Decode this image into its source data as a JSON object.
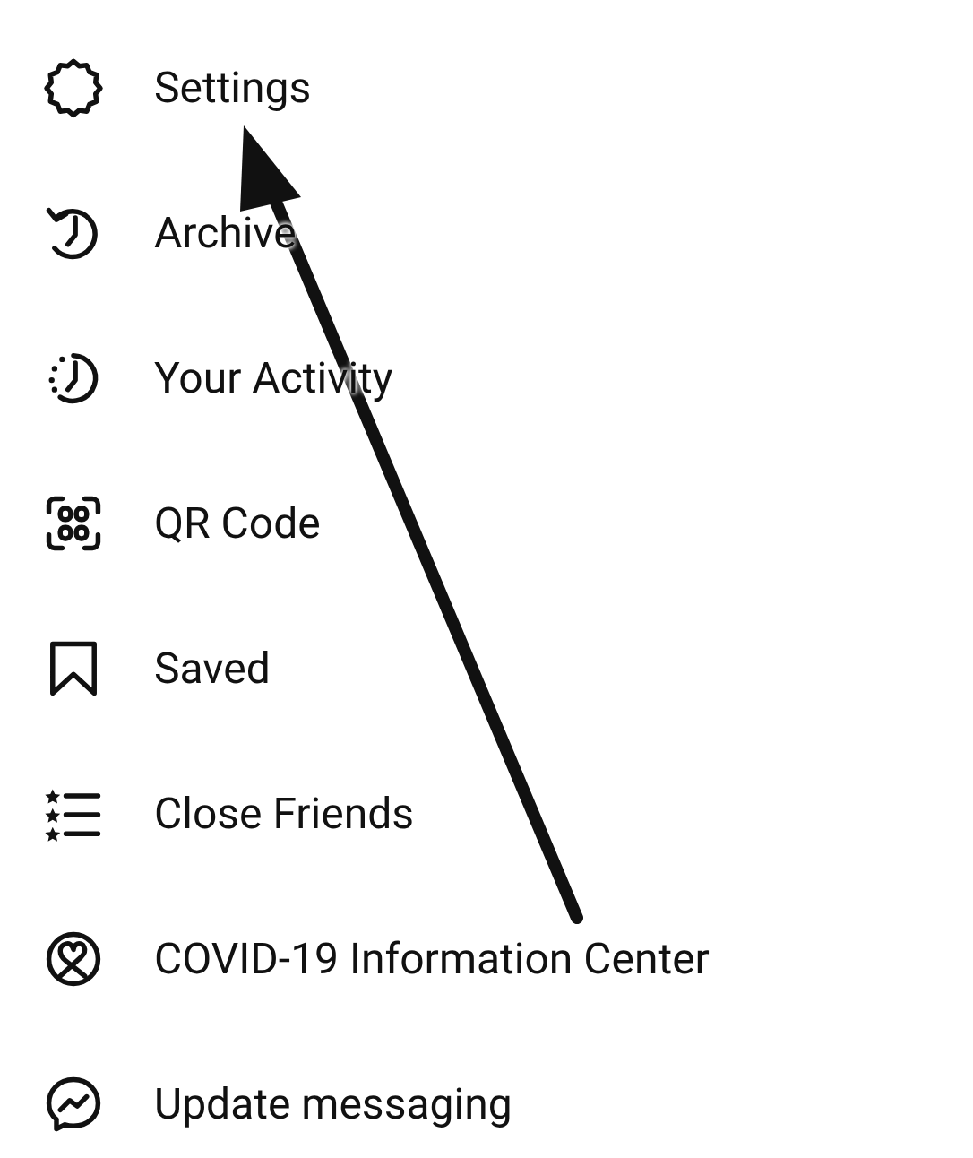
{
  "menu": {
    "items": [
      {
        "label": "Settings"
      },
      {
        "label": "Archive"
      },
      {
        "label": "Your Activity"
      },
      {
        "label": "QR Code"
      },
      {
        "label": "Saved"
      },
      {
        "label": "Close Friends"
      },
      {
        "label": "COVID-19 Information Center"
      },
      {
        "label": "Update messaging"
      }
    ]
  }
}
